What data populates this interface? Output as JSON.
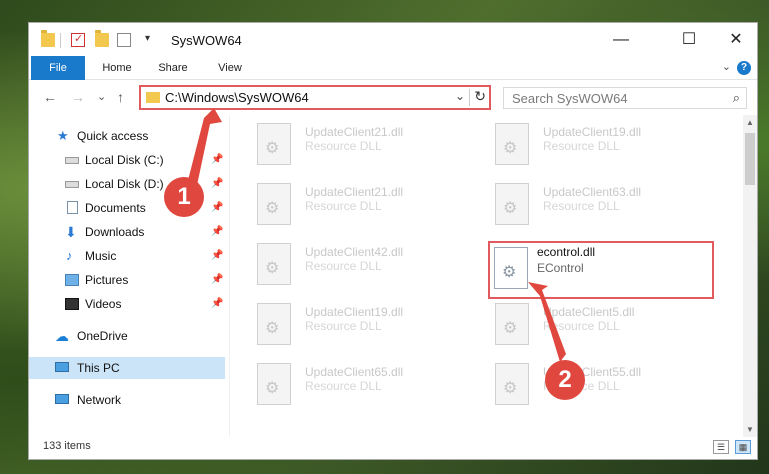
{
  "window": {
    "title": "SysWOW64",
    "minimize": "—",
    "maximize": "☐",
    "close": "✕"
  },
  "ribbon": {
    "tabs": [
      "File",
      "Home",
      "Share",
      "View"
    ],
    "help": "?",
    "expand": "⌄"
  },
  "nav": {
    "back": "←",
    "forward": "→",
    "recent": "⌄",
    "up": "↑"
  },
  "address": {
    "path": "C:\\Windows\\SysWOW64",
    "dropdown": "⌄",
    "refresh": "↻"
  },
  "search": {
    "placeholder": "Search SysWOW64",
    "icon": "⌕"
  },
  "sidebar": {
    "items": [
      {
        "label": "Quick access",
        "icon": "star-icon"
      },
      {
        "label": "Local Disk (C:)",
        "icon": "drive-icon",
        "pinned": true
      },
      {
        "label": "Local Disk (D:)",
        "icon": "drive-icon",
        "pinned": true
      },
      {
        "label": "Documents",
        "icon": "document-icon",
        "pinned": true
      },
      {
        "label": "Downloads",
        "icon": "download-icon",
        "pinned": true
      },
      {
        "label": "Music",
        "icon": "music-icon",
        "pinned": true
      },
      {
        "label": "Pictures",
        "icon": "pictures-icon",
        "pinned": true
      },
      {
        "label": "Videos",
        "icon": "videos-icon",
        "pinned": true
      },
      {
        "label": "OneDrive",
        "icon": "cloud-icon"
      },
      {
        "label": "This PC",
        "icon": "computer-icon",
        "selected": true
      },
      {
        "label": "Network",
        "icon": "network-icon"
      }
    ],
    "pin_glyph": "📌"
  },
  "files": [
    {
      "name": "UpdateClient21.dll",
      "desc": "Resource DLL"
    },
    {
      "name": "UpdateClient19.dll",
      "desc": "Resource DLL"
    },
    {
      "name": "UpdateClient21.dll",
      "desc": "Resource DLL"
    },
    {
      "name": "UpdateClient63.dll",
      "desc": "Resource DLL"
    },
    {
      "name": "UpdateClient42.dll",
      "desc": "Resource DLL"
    },
    {
      "name": "econtrol.dll",
      "desc": "EControl",
      "highlighted": true
    },
    {
      "name": "UpdateClient19.dll",
      "desc": "Resource DLL"
    },
    {
      "name": "UpdateClient5.dll",
      "desc": "Resource DLL"
    },
    {
      "name": "UpdateClient65.dll",
      "desc": "Resource DLL"
    },
    {
      "name": "UpdateClient55.dll",
      "desc": "Resource DLL"
    }
  ],
  "status": {
    "count": "133 items",
    "details_view": "☰",
    "tiles_view": "▦"
  },
  "annotations": {
    "step1": "1",
    "step2": "2"
  },
  "colors": {
    "accent": "#1979ca",
    "highlight_border": "#e05a5e",
    "selected_bg": "#cce4f7",
    "badge": "#e0483f"
  }
}
